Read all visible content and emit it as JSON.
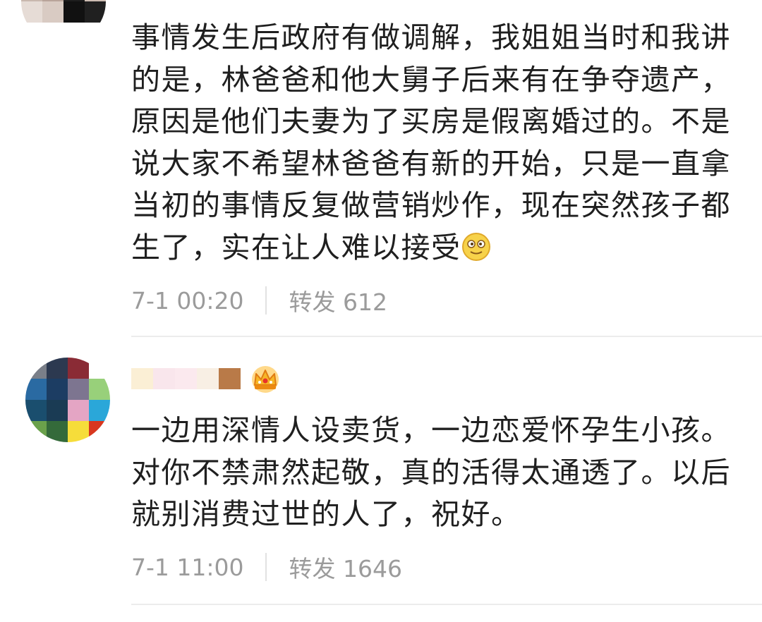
{
  "comments": [
    {
      "text": "事情发生后政府有做调解，我姐姐当时和我讲的是，林爸爸和他大舅子后来有在争夺遗产，原因是他们夫妻为了买房是假离婚过的。不是说大家不希望林爸爸有新的开始，只是一直拿当初的事情反复做营销炒作，现在突然孩子都生了，实在让人难以接受",
      "emoji": "dizzy-smile-emoji",
      "time": "7-1 00:20",
      "repost_label": "转发",
      "repost_count": "612"
    },
    {
      "text": "一边用深情人设卖货，一边恋爱怀孕生小孩。对你不禁肃然起敬，真的活得太通透了。以后就别消费过世的人了，祝好。",
      "badge": "crown-icon",
      "time": "7-1 11:00",
      "repost_label": "转发",
      "repost_count": "1646"
    }
  ],
  "colors": {
    "text": "#1f1f1f",
    "meta": "#9b9b9b",
    "divider": "#ececec"
  }
}
